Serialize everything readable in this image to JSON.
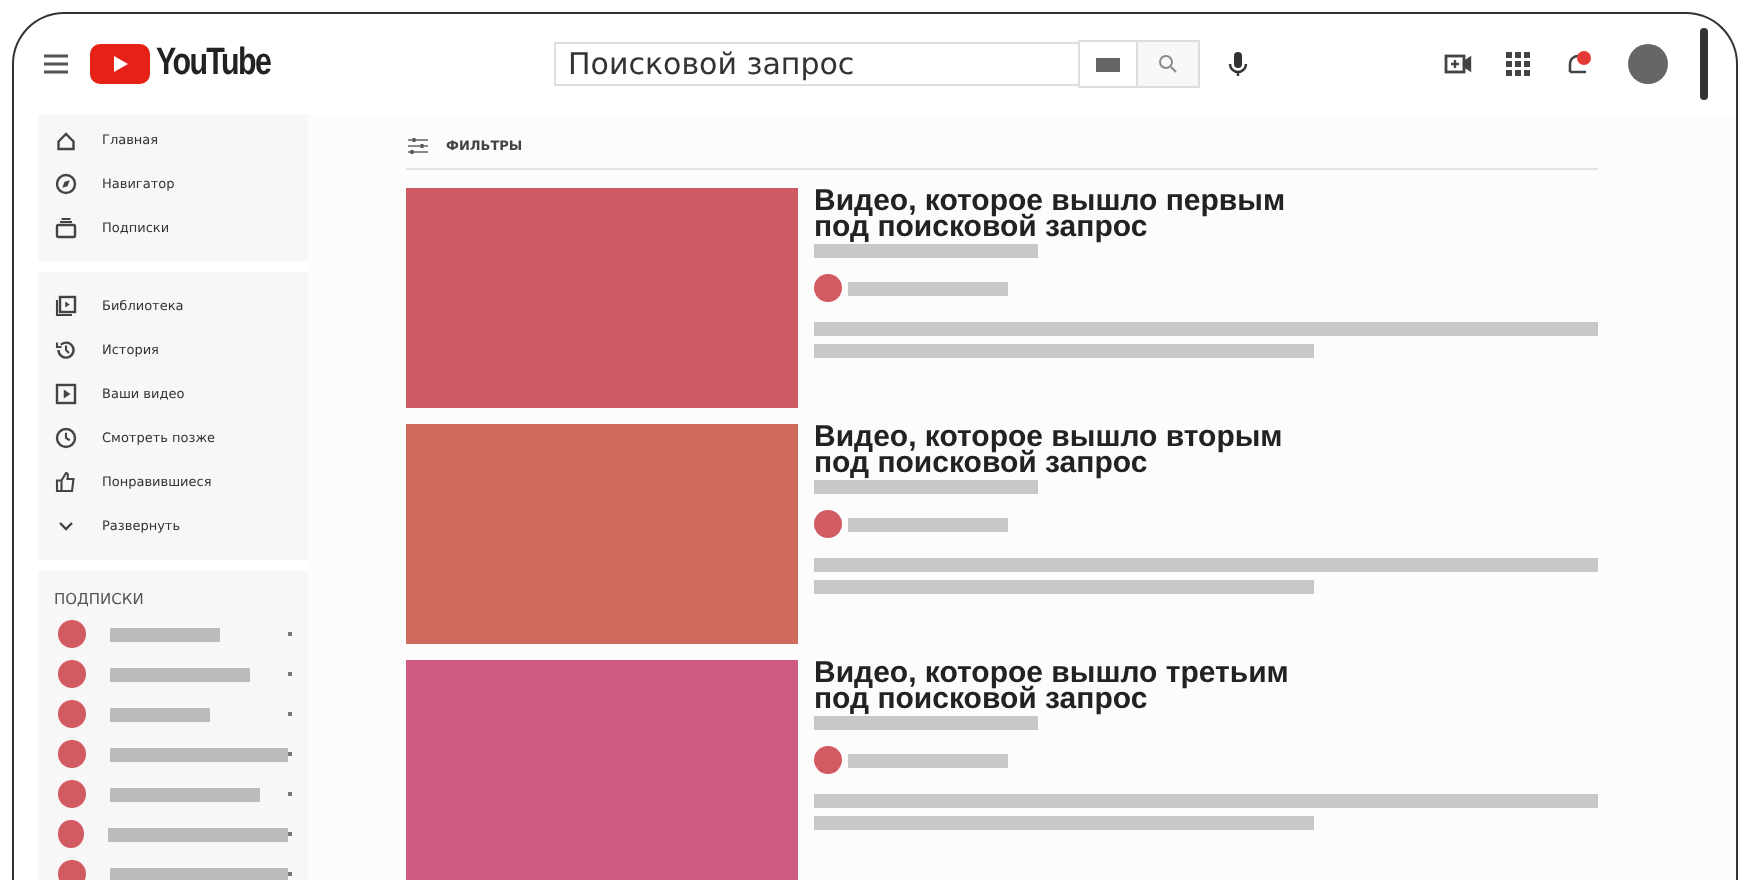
{
  "header": {
    "logo": "YouTube",
    "search": {
      "value": "Поисковой запрос"
    }
  },
  "sidebar": {
    "items": [
      {
        "kind": "home",
        "label": "Главная",
        "selected": false
      },
      {
        "kind": "compass",
        "label": "Навигатор",
        "selected": false
      },
      {
        "kind": "subs",
        "label": "Подписки",
        "selected": false
      },
      {
        "kind": "library",
        "label": "Библиотека",
        "selected": false
      },
      {
        "kind": "history",
        "label": "История",
        "selected": false
      },
      {
        "kind": "play",
        "label": "Ваши видео",
        "selected": false
      },
      {
        "kind": "clock",
        "label": "Смотреть позже",
        "selected": false
      },
      {
        "kind": "like",
        "label": "Понравившиеся",
        "selected": false
      },
      {
        "kind": "chevron",
        "label": "Развернуть",
        "selected": false
      }
    ],
    "subscriptions_title": "ПОДПИСКИ"
  },
  "filters": {
    "label": "ФИЛЬТРЫ"
  },
  "videos": [
    {
      "title": "Видео, которое вышло первым под поисковой запрос",
      "color": "#cf5a63"
    },
    {
      "title": "Видео, которое вышло вторым под поисковой запрос",
      "color": "#cf6b5c"
    },
    {
      "title": "Видео, которое вышло третьим под поисковой запрос",
      "color": "#cf5a82"
    }
  ]
}
